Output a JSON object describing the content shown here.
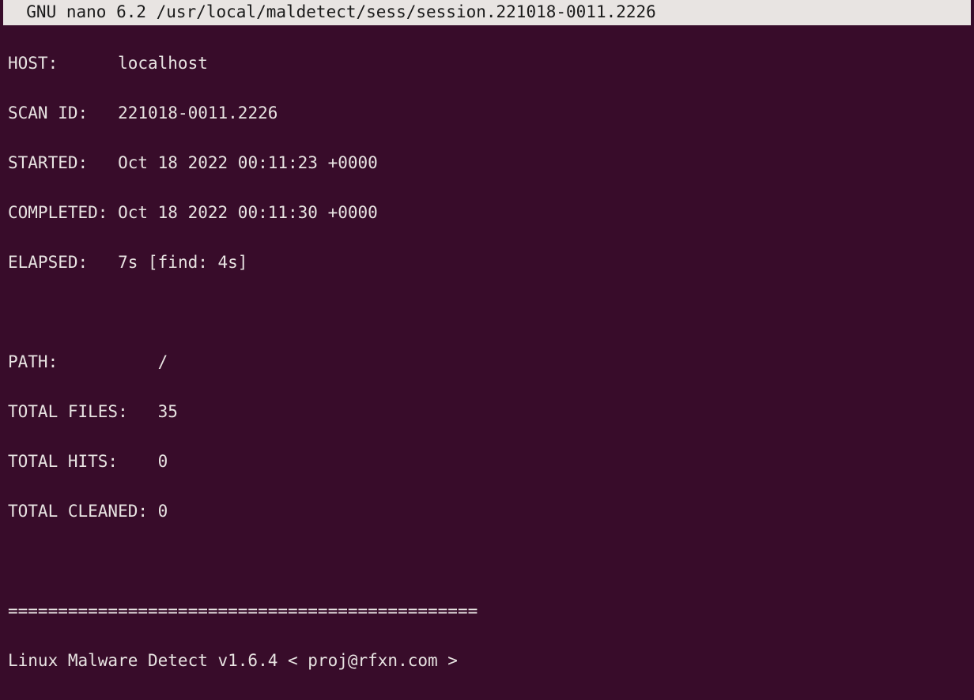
{
  "titlebar": {
    "text": "  GNU nano 6.2 /usr/local/maldetect/sess/session.221018-0011.2226             "
  },
  "session": {
    "host_label": "HOST:",
    "host_value": "localhost",
    "scanid_label": "SCAN ID:",
    "scanid_value": "221018-0011.2226",
    "started_label": "STARTED:",
    "started_value": "Oct 18 2022 00:11:23 +0000",
    "completed_label": "COMPLETED:",
    "completed_value": "Oct 18 2022 00:11:30 +0000",
    "elapsed_label": "ELAPSED:",
    "elapsed_value": "7s [find: 4s]",
    "path_label": "PATH:",
    "path_value": "/",
    "totalfiles_label": "TOTAL FILES:",
    "totalfiles_value": "35",
    "totalhits_label": "TOTAL HITS:",
    "totalhits_value": "0",
    "totalcleaned_label": "TOTAL CLEANED:",
    "totalcleaned_value": "0"
  },
  "divider": "===============================================",
  "footer": "Linux Malware Detect v1.6.4 < proj@rfxn.com >"
}
